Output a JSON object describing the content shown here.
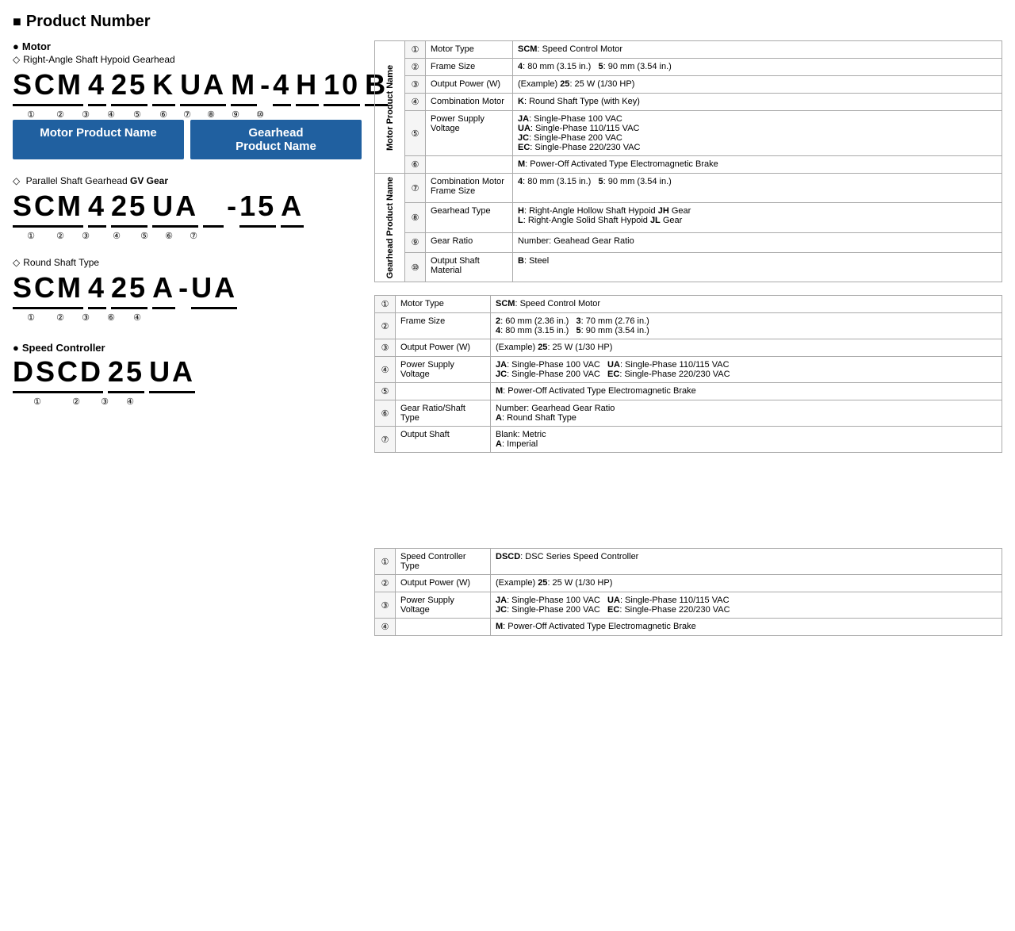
{
  "title": "Product Number",
  "motor_label": "Motor",
  "gearhead1_label": "Right-Angle Shaft Hypoid Gearhead",
  "gearhead2_label": "Parallel Shaft Gearhead GV Gear",
  "gearhead3_label": "Round Shaft Type",
  "speed_controller_label": "Speed Controller",
  "code1": {
    "motor_part": "SCM 4 25 K UA M",
    "dash": "-",
    "gearhead_part": "4 H 10 B",
    "motor_chars": "SCM",
    "c2": "4",
    "c3": "25",
    "c4": "K",
    "c5": "UA",
    "c6": "M",
    "c7": "4",
    "c8": "H",
    "c9": "10",
    "c10": "B",
    "nums": [
      "①",
      "②",
      "③",
      "④",
      "⑤",
      "⑥",
      "⑦",
      "⑧",
      "⑨",
      "⑩"
    ]
  },
  "code2": {
    "c1": "SCM",
    "c2": "4",
    "c3": "25",
    "c4": "UA",
    "dash": "-",
    "c6": "15",
    "c7": "A",
    "nums": [
      "①",
      "②",
      "③",
      "④",
      "⑤",
      "⑥",
      "⑦"
    ]
  },
  "code3": {
    "c1": "SCM",
    "c2": "4",
    "c3": "25",
    "c4": "A",
    "dash": "-",
    "c5": "UA",
    "nums": [
      "①",
      "②",
      "③",
      "⑥",
      "④"
    ]
  },
  "code4": {
    "c1": "DSCD",
    "c2": "25",
    "c3": "UA",
    "nums": [
      "①",
      "②",
      "③",
      "④"
    ]
  },
  "name_box_motor": "Motor Product Name",
  "name_box_gearhead": "Gearhead\nProduct Name",
  "table1": {
    "group_motor": "Motor\nProduct\nName",
    "group_gearhead": "Gearhead\nProduct\nName",
    "rows": [
      {
        "num": "①",
        "field": "Motor Type",
        "value": "<b>SCM</b>: Speed Control Motor"
      },
      {
        "num": "②",
        "field": "Frame Size",
        "value": "<b>4</b>: 80 mm (3.15 in.)   <b>5</b>: 90 mm (3.54 in.)"
      },
      {
        "num": "③",
        "field": "Output Power (W)",
        "value": "(Example) <b>25</b>: 25 W (1/30 HP)"
      },
      {
        "num": "④",
        "field": "Combination Motor",
        "value": "<b>K</b>: Round Shaft Type (with Key)"
      },
      {
        "num": "⑤",
        "field": "Power Supply Voltage",
        "value": "<b>JA</b>: Single-Phase 100 VAC\n<b>UA</b>: Single-Phase 110/115 VAC\n<b>JC</b>: Single-Phase 200 VAC\n<b>EC</b>: Single-Phase 220/230 VAC"
      },
      {
        "num": "⑥",
        "field": "",
        "value": "<b>M</b>: Power-Off Activated Type Electromagnetic Brake"
      },
      {
        "num": "⑦",
        "field": "Combination Motor\nFrame Size",
        "value": "<b>4</b>: 80 mm (3.15 in.)   <b>5</b>: 90 mm (3.54 in.)"
      },
      {
        "num": "⑧",
        "field": "Gearhead Type",
        "value": "<b>H</b>: Right-Angle Hollow Shaft Hypoid <b>JH</b> Gear\n<b>L</b>: Right-Angle Solid Shaft Hypoid <b>JL</b> Gear"
      },
      {
        "num": "⑨",
        "field": "Gear Ratio",
        "value": "Number: Geahead Gear Ratio"
      },
      {
        "num": "⑩",
        "field": "Output Shaft Material",
        "value": "<b>B</b>: Steel"
      }
    ]
  },
  "table2": {
    "rows": [
      {
        "num": "①",
        "field": "Motor Type",
        "value": "<b>SCM</b>: Speed Control Motor"
      },
      {
        "num": "②",
        "field": "Frame Size",
        "value": "<b>2</b>: 60 mm (2.36 in.)   <b>3</b>: 70 mm (2.76 in.)\n<b>4</b>: 80 mm (3.15 in.)   <b>5</b>: 90 mm (3.54 in.)"
      },
      {
        "num": "③",
        "field": "Output Power (W)",
        "value": "(Example) <b>25</b>: 25 W (1/30 HP)"
      },
      {
        "num": "④",
        "field": "Power Supply Voltage",
        "value": "<b>JA</b>: Single-Phase 100 VAC   <b>UA</b>: Single-Phase 110/115 VAC\n<b>JC</b>: Single-Phase 200 VAC   <b>EC</b>: Single-Phase 220/230 VAC"
      },
      {
        "num": "⑤",
        "field": "",
        "value": "<b>M</b>: Power-Off Activated Type Electromagnetic Brake"
      },
      {
        "num": "⑥",
        "field": "Gear Ratio/Shaft\nType",
        "value": "Number: Gearhead Gear Ratio\n<b>A</b>: Round Shaft Type"
      },
      {
        "num": "⑦",
        "field": "Output Shaft",
        "value": "Blank: Metric\n<b>A</b>: Imperial"
      }
    ]
  },
  "table3": {
    "rows": [
      {
        "num": "①",
        "field": "Speed Controller\nType",
        "value": "<b>DSCD</b>: DSC Series Speed Controller"
      },
      {
        "num": "②",
        "field": "Output Power (W)",
        "value": "(Example) <b>25</b>: 25 W (1/30 HP)"
      },
      {
        "num": "③",
        "field": "Power Supply Voltage",
        "value": "<b>JA</b>: Single-Phase 100 VAC   <b>UA</b>: Single-Phase 110/115 VAC\n<b>JC</b>: Single-Phase 200 VAC   <b>EC</b>: Single-Phase 220/230 VAC"
      },
      {
        "num": "④",
        "field": "",
        "value": "<b>M</b>: Power-Off Activated Type Electromagnetic Brake"
      }
    ]
  }
}
